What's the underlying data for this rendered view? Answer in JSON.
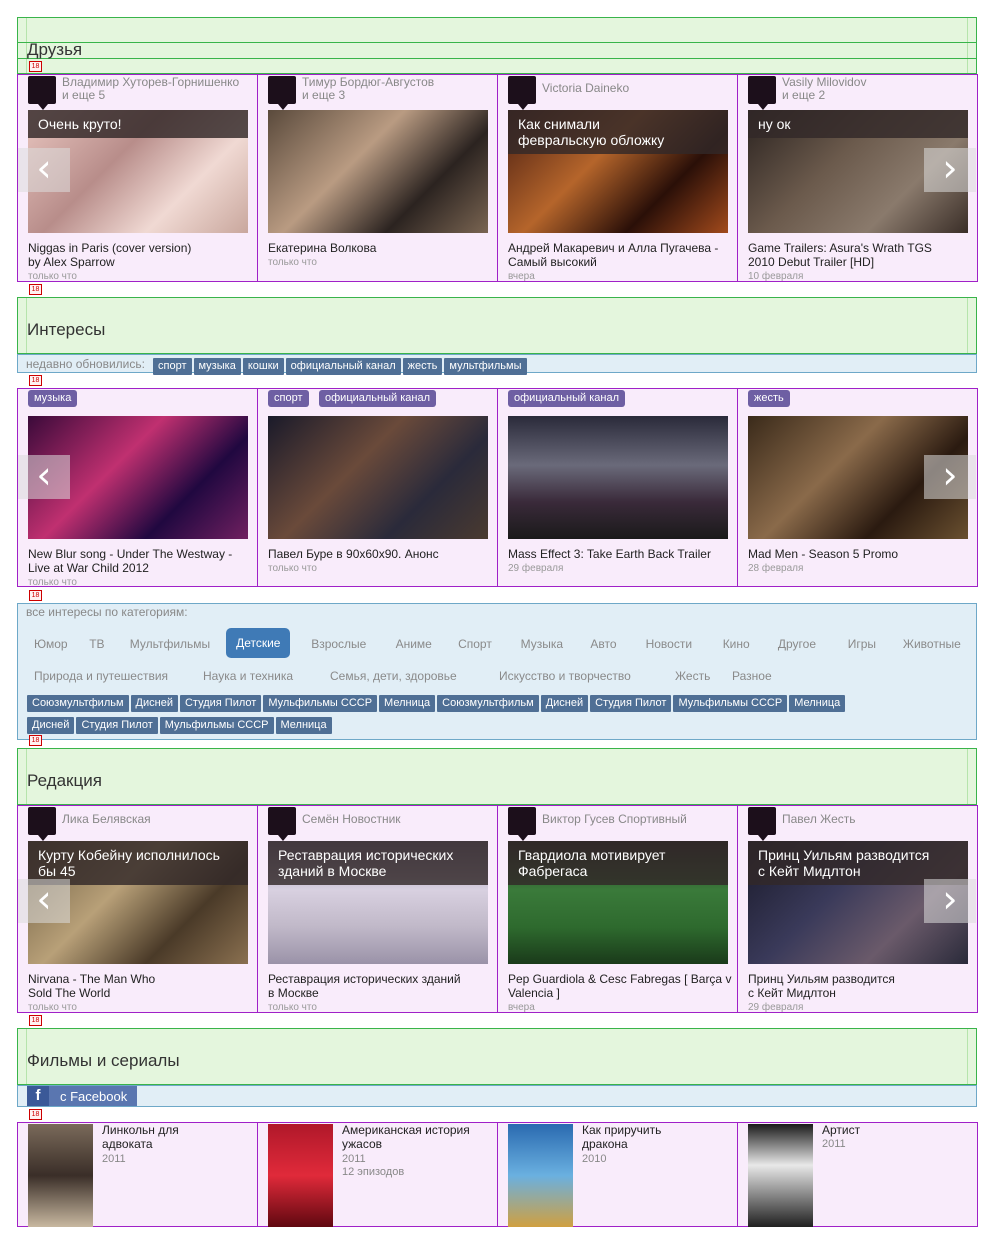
{
  "friends": {
    "title": "Друзья",
    "items": [
      {
        "users": "Владимир Хуторев-Горнишенко\nи еще 5",
        "caption": "Очень круто!",
        "title": "Niggas in Paris (cover version)\nby Alex Sparrow",
        "time": "только что"
      },
      {
        "users": "Тимур Бордюг-Августов\nи еще 3",
        "caption": "",
        "title": "Екатерина Волкова",
        "time": "только что"
      },
      {
        "users": "Victoria Daineko",
        "caption": "Как снимали\nфевральскую обложку",
        "title": "Андрей Макаревич и Алла Пугачева -\nСамый высокий",
        "time": "вчера"
      },
      {
        "users": "Vasily Milovidov\nи еще 2",
        "caption": "ну ок",
        "title": "Game Trailers: Asura's Wrath TGS\n2010 Debut Trailer [HD]",
        "time": "10 февраля"
      }
    ]
  },
  "interests": {
    "title": "Интересы",
    "recent_label": "недавно обновились:",
    "recent_tags": [
      "спорт",
      "музыка",
      "кошки",
      "официальный канал",
      "жесть",
      "мультфильмы"
    ],
    "items": [
      {
        "tags": [
          "музыка"
        ],
        "title": "New Blur song - Under The Westway -\nLive at War Child 2012",
        "time": "только что"
      },
      {
        "tags": [
          "спорт",
          "официальный канал"
        ],
        "title": "Павел Буре в 90х60х90. Анонс",
        "time": "только что"
      },
      {
        "tags": [
          "официальный канал"
        ],
        "title": "Mass Effect 3: Take Earth Back Trailer",
        "time": "29 февраля"
      },
      {
        "tags": [
          "жесть"
        ],
        "title": "Mad Men - Season 5 Promo",
        "time": "28 февраля"
      }
    ],
    "categories_label": "все интересы по категориям:",
    "categories_row1": [
      "Юмор",
      "ТВ",
      "Мультфильмы",
      "Детские",
      "Взрослые",
      "Аниме",
      "Спорт",
      "Музыка",
      "Авто",
      "Новости",
      "Кино",
      "Другое",
      "Игры",
      "Животные"
    ],
    "categories_row2": [
      "Природа и путешествия",
      "Наука и техника",
      "Семья, дети, здоровье",
      "Искусство и творчество",
      "Жесть",
      "Разное"
    ],
    "active_category": "Детские",
    "channel_tags_row1": [
      "Союзмультфильм",
      "Дисней",
      "Студия Пилот",
      "Мульфильмы СССР",
      "Мелница",
      "Союзмультфильм",
      "Дисней",
      "Студия Пилот",
      "Мульфильмы СССР",
      "Мелница"
    ],
    "channel_tags_row2": [
      "Дисней",
      "Студия Пилот",
      "Мульфильмы СССР",
      "Мелница"
    ]
  },
  "editorial": {
    "title": "Редакция",
    "items": [
      {
        "users": "Лика Белявская",
        "caption": "Курту Кобейну исполнилось\nбы 45",
        "title": "Nirvana - The Man Who\nSold The World",
        "time": "только что"
      },
      {
        "users": "Семён Новостник",
        "caption": "Реставрация исторических\nзданий в Москве",
        "title": "Реставрация исторических зданий\nв Москве",
        "time": "только что"
      },
      {
        "users": "Виктор Гусев Спортивный",
        "caption": "Гвардиола мотивирует\nФабрегаса",
        "title": "Pep Guardiola & Cesc Fabregas [ Barça v\nValencia ]",
        "time": "вчера"
      },
      {
        "users": "Павел Жесть",
        "caption": "Принц Уильям разводится\nс Кейт Мидлтон",
        "title": "Принц Уильям разводится\nс Кейт Мидлтон",
        "time": "29 февраля"
      }
    ]
  },
  "films": {
    "title": "Фильмы и сериалы",
    "facebook_label": "с Facebook",
    "items": [
      {
        "title": "Линкольн для\nадвоката",
        "year": "2011",
        "extra": ""
      },
      {
        "title": "Американская история\nужасов",
        "year": "2011",
        "extra": "12 эпизодов"
      },
      {
        "title": "Как приручить\nдракона",
        "year": "2010",
        "extra": ""
      },
      {
        "title": "Артист",
        "year": "2011",
        "extra": ""
      }
    ]
  },
  "marker": "18",
  "top_marker": "88",
  "colors": {
    "accent": "#3f7ab6",
    "tag": "#4f6f95",
    "purple_tag": "#6e5fa3"
  }
}
